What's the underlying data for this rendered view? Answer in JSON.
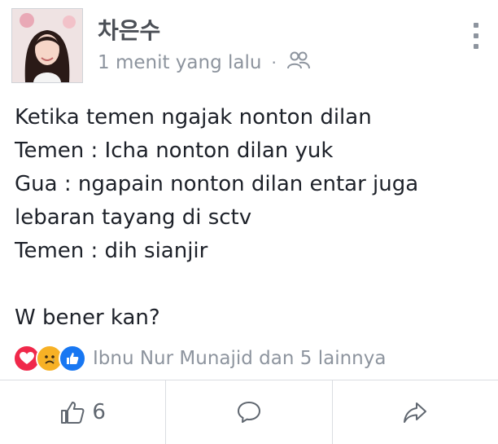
{
  "post": {
    "author": "차은수",
    "time": "1 menit yang lalu",
    "separator": "·",
    "audience_icon": "friends-icon",
    "lines": [
      "Ketika temen ngajak nonton dilan",
      "Temen : Icha nonton dilan yuk",
      "Gua : ngapain nonton dilan entar juga",
      "lebaran tayang di sctv",
      "Temen : dih sianjir",
      "",
      "W bener kan?"
    ]
  },
  "reactions": {
    "icons": [
      "love-reaction-icon",
      "sad-reaction-icon",
      "like-reaction-icon"
    ],
    "summary": "Ibnu Nur Munajid dan 5 lainnya"
  },
  "actions": {
    "like_count": "6"
  },
  "colors": {
    "love": "#f0284a",
    "sad": "#f7b125",
    "like": "#1877f2",
    "muted": "#8d949e"
  }
}
